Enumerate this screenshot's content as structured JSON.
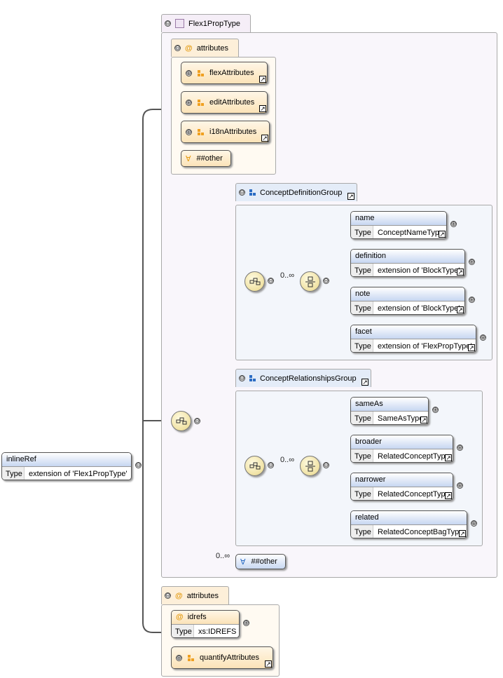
{
  "root_element": {
    "name": "inlineRef",
    "type_label": "Type",
    "type_value": "extension of 'Flex1PropType'"
  },
  "complex_type": {
    "name": "Flex1PropType"
  },
  "attributes_top": {
    "label": "attributes",
    "groups": [
      "flexAttributes",
      "editAttributes",
      "i18nAttributes"
    ],
    "any_attribute": "##other"
  },
  "concept_definition_group": {
    "name": "ConceptDefinitionGroup",
    "occurrence": "0..∞",
    "elements": [
      {
        "name": "name",
        "type_label": "Type",
        "type_value": "ConceptNameType"
      },
      {
        "name": "definition",
        "type_label": "Type",
        "type_value": "extension of 'BlockType'"
      },
      {
        "name": "note",
        "type_label": "Type",
        "type_value": "extension of 'BlockType'"
      },
      {
        "name": "facet",
        "type_label": "Type",
        "type_value": "extension of 'FlexPropType'"
      }
    ]
  },
  "concept_relationships_group": {
    "name": "ConceptRelationshipsGroup",
    "occurrence": "0..∞",
    "elements": [
      {
        "name": "sameAs",
        "type_label": "Type",
        "type_value": "SameAsType"
      },
      {
        "name": "broader",
        "type_label": "Type",
        "type_value": "RelatedConceptType"
      },
      {
        "name": "narrower",
        "type_label": "Type",
        "type_value": "RelatedConceptType"
      },
      {
        "name": "related",
        "type_label": "Type",
        "type_value": "RelatedConceptBagType"
      }
    ]
  },
  "any_element": {
    "occurrence": "0..∞",
    "label": "##other"
  },
  "attributes_bottom": {
    "label": "attributes",
    "attribute": {
      "name": "idrefs",
      "type_label": "Type",
      "type_value": "xs:IDREFS"
    },
    "group": "quantifyAttributes"
  },
  "icons": {
    "collapse": "⊖",
    "expand": "⊕",
    "attribute": "@",
    "any": "∀",
    "reference": "↗"
  },
  "colors": {
    "element_header": "#c6d6f1",
    "attr_group": "#fbe3b8",
    "compositor": "#f0e2a4",
    "group_icon_blue": "#2b6cc4",
    "attr_icon_orange": "#f0a020"
  }
}
